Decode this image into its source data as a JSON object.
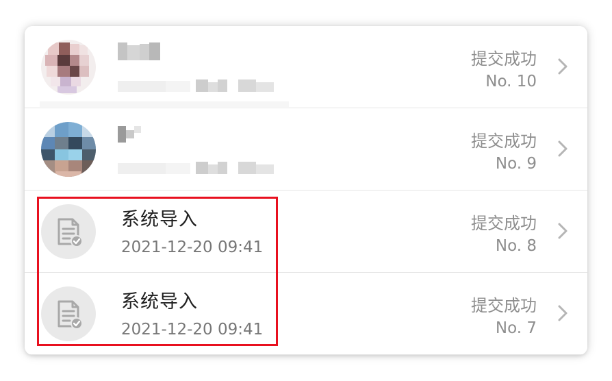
{
  "records": [
    {
      "id_label": "No. 10",
      "status": "提交成功",
      "name": "",
      "time": "",
      "avatar_type": "photo-blurred"
    },
    {
      "id_label": "No. 9",
      "status": "提交成功",
      "name": "",
      "time": "",
      "avatar_type": "photo-blurred"
    },
    {
      "id_label": "No. 8",
      "status": "提交成功",
      "name": "系统导入",
      "time": "2021-12-20 09:41",
      "avatar_type": "document-check-icon"
    },
    {
      "id_label": "No. 7",
      "status": "提交成功",
      "name": "系统导入",
      "time": "2021-12-20 09:41",
      "avatar_type": "document-check-icon"
    }
  ],
  "icons": {
    "chevron": "chevron-right-icon",
    "document": "document-check-icon"
  },
  "colors": {
    "highlight_border": "#e8101f",
    "status_text": "#8e8e8e",
    "title_text": "#1f1f1f",
    "subtitle_text": "#777777",
    "icon_background": "#e9e9e9"
  }
}
